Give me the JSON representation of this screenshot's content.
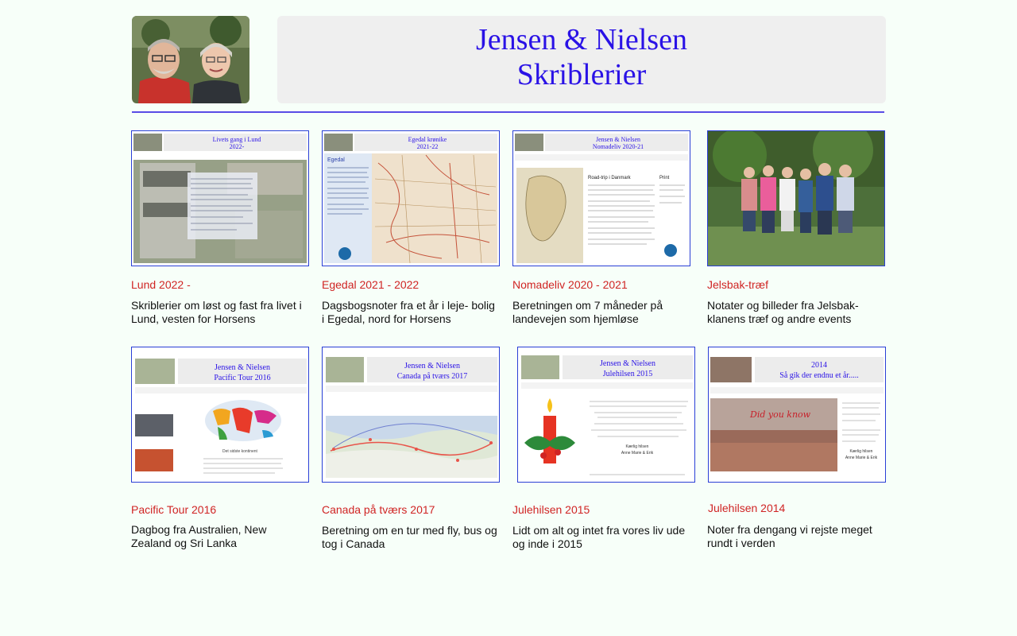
{
  "header": {
    "title_line1": "Jensen & Nielsen",
    "title_line2": "Skriblerier",
    "colors": {
      "title": "#2a12e6",
      "rule": "#5a4ce6",
      "card_title": "#d02424",
      "thumb_border": "#2a3fd6"
    }
  },
  "cards": [
    {
      "title": "Lund 2022 -",
      "description": "Skriblerier om løst og fast fra livet i Lund, vesten for Horsens",
      "thumb": {
        "heading1": "Livets gang i Lund",
        "heading2": "2022-"
      }
    },
    {
      "title": "Egedal 2021 - 2022",
      "description": "Dagsbogsnoter fra et år i leje- bolig i Egedal, nord for Horsens",
      "thumb": {
        "heading1": "Egedal krønike",
        "heading2": "2021-22",
        "side_label": "Egedal"
      }
    },
    {
      "title": "Nomadeliv 2020 - 2021",
      "description": "Beretningen om 7 måneder på landevejen som hjemløse",
      "thumb": {
        "heading1": "Jensen & Nielsen",
        "heading2": "Nomadeliv 2020-21",
        "col_heading": "Road-trip i Danmark",
        "side_heading": "Print"
      }
    },
    {
      "title": "Jelsbak-træf",
      "description": "Notater og billeder fra Jelsbak-klanens træf og andre events",
      "thumb": {}
    },
    {
      "title": "Pacific Tour 2016",
      "description": "Dagbog fra Australien, New Zealand og Sri Lanka",
      "thumb": {
        "heading1": "Jensen & Nielsen",
        "heading2": "Pacific Tour 2016",
        "caption": "Det sidste kontinent"
      }
    },
    {
      "title": "Canada på tværs 2017",
      "description": "Beretning om en tur med fly, bus og tog i Canada",
      "thumb": {
        "heading1": "Jensen & Nielsen",
        "heading2": "Canada på tværs 2017"
      }
    },
    {
      "title": "Julehilsen 2015",
      "description": "Lidt om alt og intet fra vores liv ude og inde i 2015",
      "thumb": {
        "heading1": "Jensen & Nielsen",
        "heading2": "Julehilsen 2015",
        "greeting": "Kærlig hilsen",
        "names": "Anne Marie & Erik"
      }
    },
    {
      "title": "Julehilsen 2014",
      "description": "Noter fra dengang vi rejste meget rundt i verden",
      "thumb": {
        "heading1": "2014",
        "heading2": "Så gik der endnu et år.....",
        "script": "Did you know",
        "greeting": "Kærlig hilsen",
        "names": "Anne Marie & Erik"
      }
    }
  ]
}
